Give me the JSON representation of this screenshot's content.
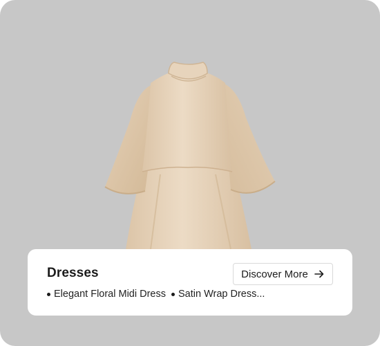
{
  "card": {
    "background": "#c7c7c7",
    "image": {
      "name": "dress-image",
      "color": "#e8d5bd"
    }
  },
  "panel": {
    "title": "Dresses",
    "cta": {
      "label": "Discover More",
      "icon": "arrow-right-icon"
    },
    "items": [
      {
        "label": "Elegant Floral Midi Dress"
      },
      {
        "label": "Satin Wrap Dress..."
      }
    ]
  }
}
